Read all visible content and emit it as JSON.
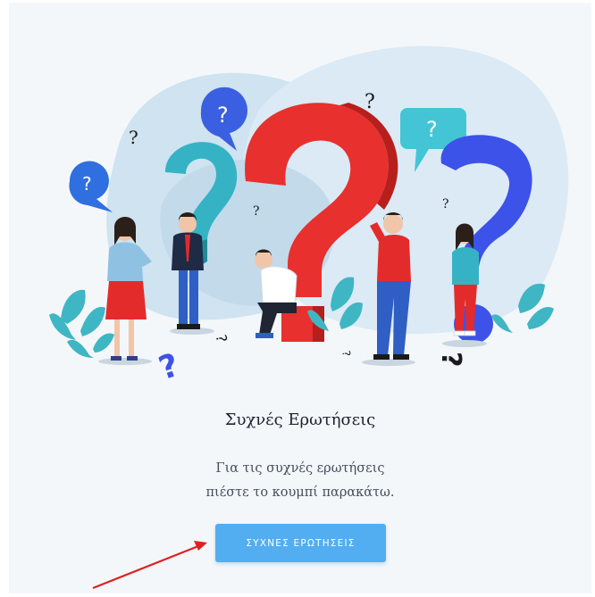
{
  "faq": {
    "title": "Συχνές Ερωτήσεις",
    "line1": "Για τις συχνές ερωτήσεις",
    "line2": "πιέστε το κουμπί παρακάτω.",
    "button_label": "ΣΥΧΝΕΣ ΕΡΩΤΗΣΕΙΣ"
  },
  "colors": {
    "accent": "#52aef0",
    "annotation_arrow": "#e02020"
  },
  "illustration": {
    "icon": "faq-people-question-marks-illustration"
  }
}
